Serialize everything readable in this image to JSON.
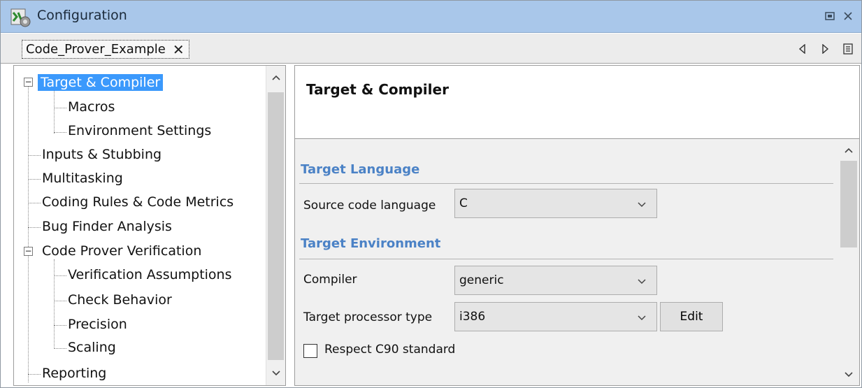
{
  "window": {
    "title": "Configuration",
    "icon": "configuration-app-icon",
    "controls": [
      "restore-icon",
      "close-icon"
    ]
  },
  "tab": {
    "label": "Code_Prover_Example",
    "close_glyph": "✕"
  },
  "tab_nav": {
    "icons": [
      "nav-left-icon",
      "nav-right-icon",
      "panel-list-icon"
    ]
  },
  "tree": {
    "items": [
      {
        "label": "Target & Compiler",
        "level": 0,
        "expanded": true,
        "selected": true
      },
      {
        "label": "Macros",
        "level": 1
      },
      {
        "label": "Environment Settings",
        "level": 1
      },
      {
        "label": "Inputs & Stubbing",
        "level": 0
      },
      {
        "label": "Multitasking",
        "level": 0
      },
      {
        "label": "Coding Rules & Code Metrics",
        "level": 0
      },
      {
        "label": "Bug Finder Analysis",
        "level": 0
      },
      {
        "label": "Code Prover Verification",
        "level": 0,
        "expanded": true
      },
      {
        "label": "Verification Assumptions",
        "level": 1
      },
      {
        "label": "Check Behavior",
        "level": 1
      },
      {
        "label": "Precision",
        "level": 1
      },
      {
        "label": "Scaling",
        "level": 1
      },
      {
        "label": "Reporting",
        "level": 0
      }
    ],
    "toggle_expanded": "−"
  },
  "panel": {
    "title": "Target & Compiler",
    "sections": {
      "target_language": "Target Language",
      "target_environment": "Target Environment"
    },
    "fields": {
      "source_code_language_label": "Source code language",
      "source_code_language_value": "C",
      "compiler_label": "Compiler",
      "compiler_value": "generic",
      "target_processor_label": "Target processor type",
      "target_processor_value": "i386",
      "edit_button": "Edit",
      "respect_c90_label": "Respect C90 standard",
      "respect_c90_checked": false
    }
  },
  "colors": {
    "titlebar": "#a9c7ea",
    "selection": "#3b99fc",
    "section_title": "#4b82c6"
  }
}
